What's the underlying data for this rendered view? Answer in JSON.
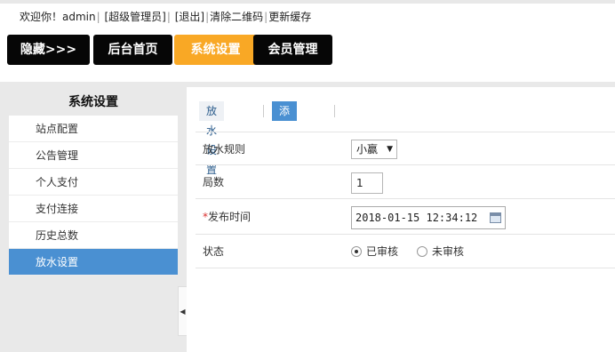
{
  "topbar": {
    "welcome": "欢迎你！admin",
    "role": "[超级管理员]",
    "logout": "[退出]",
    "clear_qrcode": "清除二维码",
    "update_cache": "更新缓存"
  },
  "nav": {
    "items": [
      {
        "label": "隐藏>>>",
        "active": false
      },
      {
        "label": "后台首页",
        "active": false
      },
      {
        "label": "系统设置",
        "active": true
      },
      {
        "label": "会员管理",
        "active": false
      }
    ]
  },
  "sidebar": {
    "title": "系统设置",
    "items": [
      {
        "label": "站点配置"
      },
      {
        "label": "公告管理"
      },
      {
        "label": "个人支付"
      },
      {
        "label": "支付连接"
      },
      {
        "label": "历史总数"
      },
      {
        "label": "放水设置"
      }
    ],
    "active_index": 5,
    "collapse_glyph": "◀"
  },
  "tabs": [
    {
      "label": "放水设置"
    },
    {
      "label": "添加规则"
    }
  ],
  "form": {
    "rule": {
      "label": "放水规则",
      "value": "小赢",
      "arrow": "▼"
    },
    "rounds": {
      "label": "局数",
      "value": "1"
    },
    "publish_time": {
      "required_mark": "*",
      "label": "发布时间",
      "value": "2018-01-15 12:34:12"
    },
    "status": {
      "label": "状态",
      "options": [
        {
          "label": "已审核",
          "checked": true
        },
        {
          "label": "未审核",
          "checked": false
        }
      ]
    }
  },
  "colors": {
    "accent": "#f9a825",
    "nav_bg": "#060606",
    "active_blue": "#4a90d2",
    "required": "#d9302f"
  }
}
